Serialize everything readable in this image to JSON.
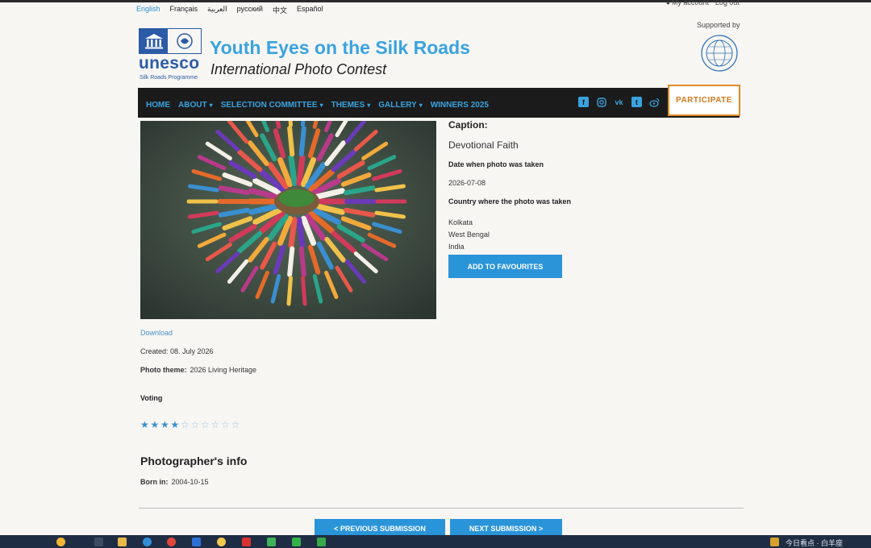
{
  "languages": [
    {
      "label": "English",
      "active": true
    },
    {
      "label": "Français",
      "active": false
    },
    {
      "label": "العربية",
      "active": false
    },
    {
      "label": "русский",
      "active": false
    },
    {
      "label": "中文",
      "active": false
    },
    {
      "label": "Español",
      "active": false
    }
  ],
  "account": {
    "my_account": "My account",
    "logout": "Log out",
    "icon": "user-icon"
  },
  "header": {
    "logo_word": "unesco",
    "logo_sub": "Silk Roads Programme",
    "title": "Youth Eyes on the Silk Roads",
    "subtitle": "International Photo Contest",
    "supported_by": "Supported by"
  },
  "nav": {
    "items": [
      {
        "label": "HOME",
        "dropdown": false
      },
      {
        "label": "ABOUT",
        "dropdown": true
      },
      {
        "label": "SELECTION COMMITTEE",
        "dropdown": true
      },
      {
        "label": "THEMES",
        "dropdown": true
      },
      {
        "label": "GALLERY",
        "dropdown": true
      },
      {
        "label": "WINNERS 2025",
        "dropdown": false
      }
    ],
    "socials": [
      "facebook-icon",
      "instagram-icon",
      "vk-icon",
      "twitter-icon",
      "weibo-icon"
    ],
    "participate": "PARTICIPATE"
  },
  "details": {
    "caption_label": "Caption:",
    "caption_value": "Devotional Faith",
    "date_label": "Date when photo was taken",
    "date_value": "2026-07-08",
    "country_label": "Country where the photo was taken",
    "location": [
      "Kolkata",
      "West Bengal",
      "India"
    ],
    "fav_button": "ADD TO FAVOURITES"
  },
  "meta": {
    "download": "Download",
    "created": "Created: 08. July 2026",
    "theme_label": "Photo theme:",
    "theme_value": "2026 Living Heritage",
    "voting": "Voting",
    "rating": 4,
    "rating_max": 10
  },
  "photographer": {
    "heading": "Photographer's info",
    "born_label": "Born in:",
    "born_value": "2004-10-15"
  },
  "pager": {
    "prev": "< PREVIOUS SUBMISSION",
    "next": "NEXT SUBMISSION >"
  },
  "taskbar": {
    "right_text": "今日看点 · 白羊座"
  },
  "colors": {
    "accent": "#2a94d9",
    "title_blue": "#3aa3df",
    "unesco_blue": "#2b5ba6",
    "nav_bg": "#1b1b1b",
    "participate_orange": "#e08a2a"
  }
}
